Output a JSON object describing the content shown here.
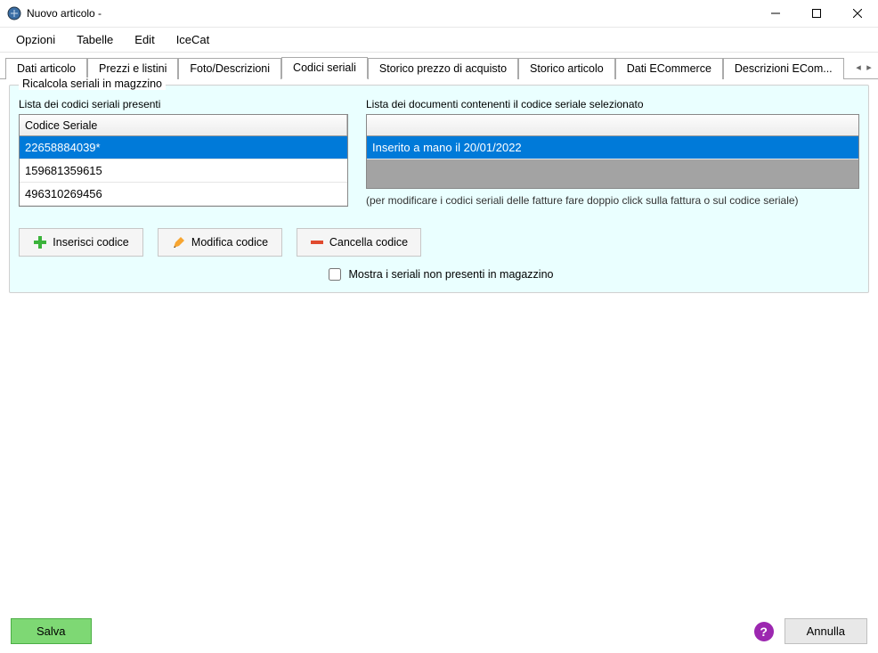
{
  "window": {
    "title": "Nuovo articolo -"
  },
  "menu": {
    "items": [
      "Opzioni",
      "Tabelle",
      "Edit",
      "IceCat"
    ]
  },
  "tabs": {
    "items": [
      "Dati articolo",
      "Prezzi e listini",
      "Foto/Descrizioni",
      "Codici seriali",
      "Storico prezzo di acquisto",
      "Storico articolo",
      "Dati ECommerce",
      "Descrizioni  ECom..."
    ],
    "active_index": 3
  },
  "groupbox": {
    "title": "Ricalcola seriali in magzzino",
    "left_label": "Lista dei codici seriali presenti",
    "right_label": "Lista dei documenti contenenti il codice seriale selezionato",
    "left_header": "Codice Seriale",
    "left_rows": [
      "22658884039*",
      "159681359615",
      "496310269456"
    ],
    "left_selected": 0,
    "right_rows": [
      "Inserito a mano il 20/01/2022"
    ],
    "right_selected": 0,
    "hint": "(per modificare i codici seriali delle fatture fare doppio click sulla fattura o sul codice seriale)",
    "btn_insert": "Inserisci codice",
    "btn_modify": "Modifica codice",
    "btn_delete": "Cancella codice",
    "checkbox_label": "Mostra i seriali non presenti in magazzino"
  },
  "footer": {
    "save": "Salva",
    "cancel": "Annulla"
  }
}
